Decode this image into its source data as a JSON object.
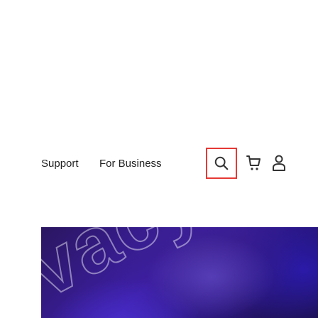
{
  "nav": {
    "support_label": "Support",
    "business_label": "For Business",
    "search_icon": "search-icon",
    "cart_icon": "shopping-cart-icon",
    "account_icon": "user-icon"
  },
  "hero": {
    "text": "vacy"
  },
  "colors": {
    "accent": "#e53935",
    "hero_primary": "#3d1fa8",
    "text": "#222222"
  }
}
